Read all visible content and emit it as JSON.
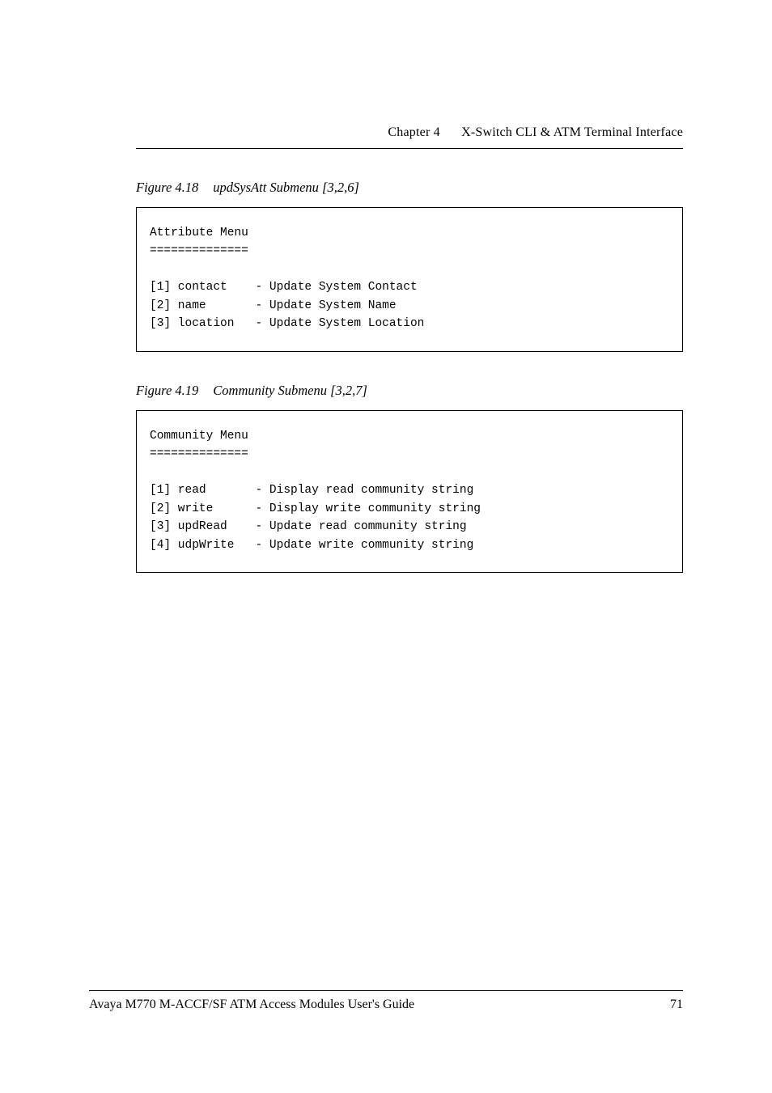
{
  "header": {
    "chapter": "Chapter 4",
    "title": "X-Switch CLI & ATM Terminal Interface"
  },
  "figure1": {
    "number": "Figure 4.18",
    "caption": "updSysAtt Submenu [3,2,6]",
    "code": "Attribute Menu\n==============\n\n[1] contact    - Update System Contact\n[2] name       - Update System Name\n[3] location   - Update System Location"
  },
  "figure2": {
    "number": "Figure 4.19",
    "caption": "Community Submenu [3,2,7]",
    "code": "Community Menu\n==============\n\n[1] read       - Display read community string\n[2] write      - Display write community string\n[3] updRead    - Update read community string\n[4] udpWrite   - Update write community string"
  },
  "footer": {
    "text": "Avaya M770 M-ACCF/SF ATM Access Modules User's Guide",
    "page": "71"
  }
}
